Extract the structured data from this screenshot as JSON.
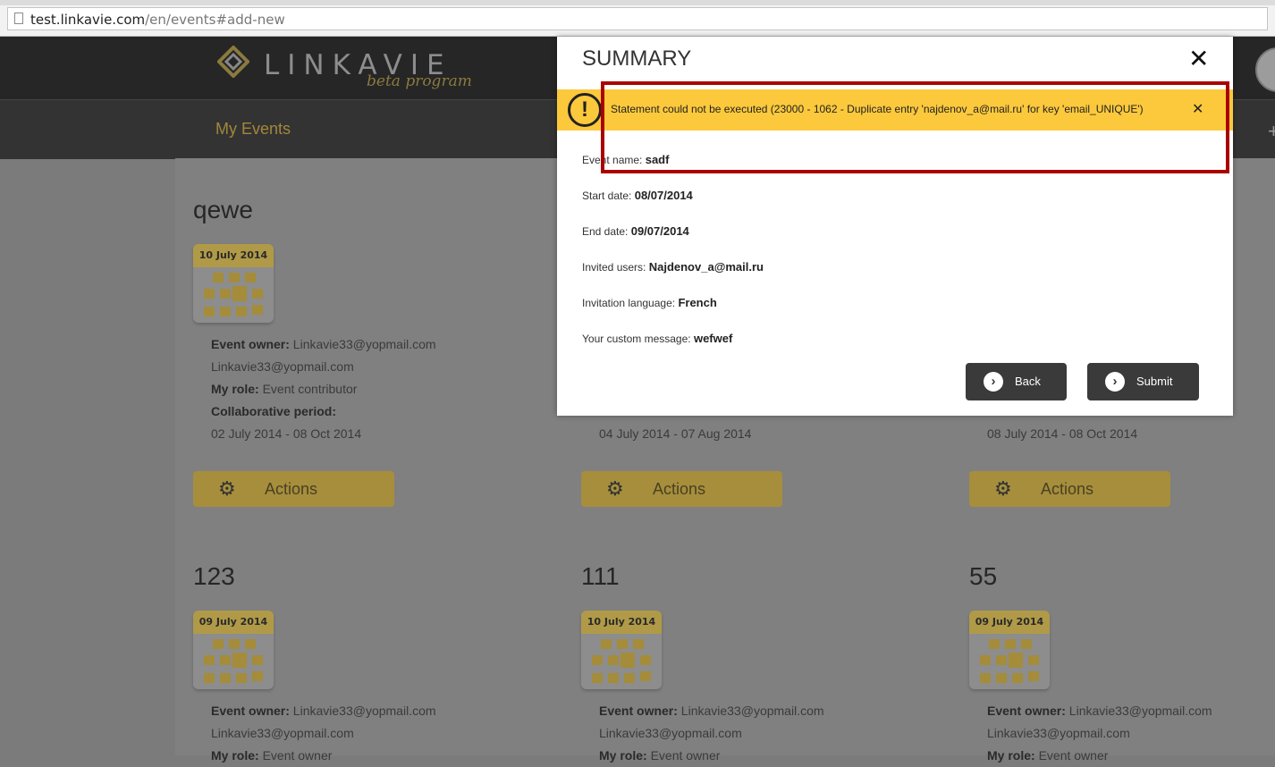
{
  "browser": {
    "url_host": "test.linkavie.com",
    "url_path": "/en/events#add-new"
  },
  "site": {
    "logo_text": "LINKAVIE",
    "logo_beta": "beta program",
    "nav_my_events": "My Events"
  },
  "events": [
    {
      "title": "qewe",
      "date": "10 July 2014",
      "owner_label": "Event owner:",
      "owner": "Linkavie33@yopmail.com",
      "owner_line2": "Linkavie33@yopmail.com",
      "role_label": "My role:",
      "role": "Event contributor",
      "period_label": "Collaborative period:",
      "period": "02 July 2014 - 08 Oct 2014",
      "actions": "Actions"
    },
    {
      "period": "04 July 2014 - 07 Aug 2014",
      "actions": "Actions"
    },
    {
      "period": "08 July 2014 - 08 Oct 2014",
      "actions": "Actions"
    },
    {
      "title": "123",
      "date": "09 July 2014",
      "owner_label": "Event owner:",
      "owner": "Linkavie33@yopmail.com",
      "owner_line2": "Linkavie33@yopmail.com",
      "role_label": "My role:",
      "role": "Event owner"
    },
    {
      "title": "111",
      "date": "10 July 2014",
      "owner_label": "Event owner:",
      "owner": "Linkavie33@yopmail.com",
      "owner_line2": "Linkavie33@yopmail.com",
      "role_label": "My role:",
      "role": "Event owner"
    },
    {
      "title": "55",
      "date": "09 July 2014",
      "owner_label": "Event owner:",
      "owner": "Linkavie33@yopmail.com",
      "owner_line2": "Linkavie33@yopmail.com",
      "role_label": "My role:",
      "role": "Event owner"
    }
  ],
  "modal": {
    "title": "SUMMARY",
    "close": "✕",
    "alert_icon": "!",
    "alert_text": "Statement could not be executed (23000 - 1062 - Duplicate entry 'najdenov_a@mail.ru' for key 'email_UNIQUE')",
    "alert_close": "✕",
    "fields": [
      {
        "label": "Event name:",
        "value": "sadf"
      },
      {
        "label": "Start date:",
        "value": "08/07/2014"
      },
      {
        "label": "End date:",
        "value": "09/07/2014"
      },
      {
        "label": "Invited users:",
        "value": "Najdenov_a@mail.ru"
      },
      {
        "label": "Invitation language:",
        "value": "French"
      },
      {
        "label": "Your custom message:",
        "value": "wefwef"
      }
    ],
    "back_label": "Back",
    "submit_label": "Submit",
    "button_icon": "›"
  },
  "colors": {
    "accent": "#fcc93c",
    "highlight": "#aa0000",
    "button": "#3a3a3a"
  }
}
